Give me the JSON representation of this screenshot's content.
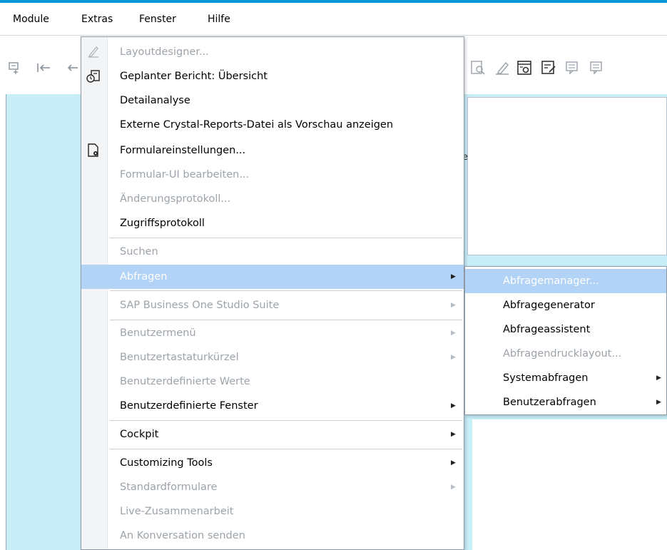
{
  "menubar": {
    "items": [
      {
        "label": "Module"
      },
      {
        "label": "Extras"
      },
      {
        "label": "Fenster"
      },
      {
        "label": "Hilfe"
      }
    ]
  },
  "background": {
    "stray_char": "e"
  },
  "extras_menu": {
    "items": [
      {
        "label": "Layoutdesigner...",
        "enabled": false,
        "icon": "pencil-icon"
      },
      {
        "label": "Geplanter Bericht: Übersicht",
        "enabled": true,
        "icon": "scheduled-report-icon"
      },
      {
        "label": "Detailanalyse",
        "enabled": true
      },
      {
        "label": "Externe Crystal-Reports-Datei als Vorschau anzeigen",
        "enabled": true
      },
      {
        "label": "Formulareinstellungen...",
        "enabled": true,
        "icon": "form-settings-icon"
      },
      {
        "label": "Formular-UI bearbeiten...",
        "enabled": false
      },
      {
        "label": "Änderungsprotokoll...",
        "enabled": false
      },
      {
        "label": "Zugriffsprotokoll",
        "enabled": true
      },
      {
        "label": "Suchen",
        "enabled": false
      },
      {
        "label": "Abfragen",
        "enabled": true,
        "submenu": true,
        "active": true
      },
      {
        "label": "SAP Business One Studio Suite",
        "enabled": false,
        "submenu": true
      },
      {
        "label": "Benutzermenü",
        "enabled": false,
        "submenu": true
      },
      {
        "label": "Benutzertastaturkürzel",
        "enabled": false,
        "submenu": true
      },
      {
        "label": "Benutzerdefinierte Werte",
        "enabled": false
      },
      {
        "label": "Benutzerdefinierte Fenster",
        "enabled": true,
        "submenu": true
      },
      {
        "label": "Cockpit",
        "enabled": true,
        "submenu": true
      },
      {
        "label": "Customizing Tools",
        "enabled": true,
        "submenu": true
      },
      {
        "label": "Standardformulare",
        "enabled": false,
        "submenu": true
      },
      {
        "label": "Live-Zusammenarbeit",
        "enabled": false
      },
      {
        "label": "An Konversation senden",
        "enabled": false
      }
    ]
  },
  "abfragen_submenu": {
    "items": [
      {
        "label": "Abfragemanager...",
        "enabled": true,
        "active": true
      },
      {
        "label": "Abfragegenerator",
        "enabled": true
      },
      {
        "label": "Abfrageassistent",
        "enabled": true
      },
      {
        "label": "Abfragendrucklayout...",
        "enabled": false
      },
      {
        "label": "Systemabfragen",
        "enabled": true,
        "submenu": true
      },
      {
        "label": "Benutzerabfragen",
        "enabled": true,
        "submenu": true
      }
    ]
  },
  "symbols": {
    "submenu_arrow": "▶"
  },
  "colors": {
    "accent_bar": "#0a96d8",
    "highlight": "#b3d3f6",
    "workspace": "#c8eef8",
    "disabled_text": "#9ca3ab"
  }
}
